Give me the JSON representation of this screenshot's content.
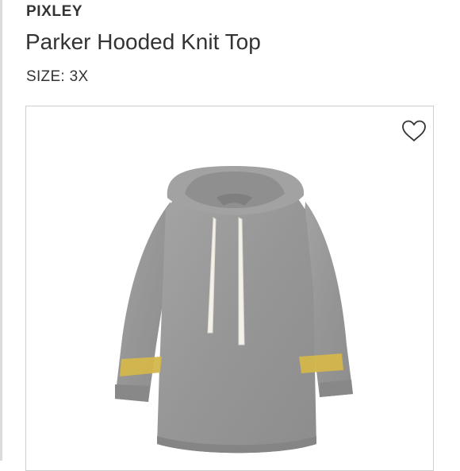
{
  "product": {
    "brand": "PIXLEY",
    "name": "Parker Hooded Knit Top",
    "size_label": "SIZE: 3X"
  },
  "image_card": {
    "favorite_icon": "heart-outline-icon",
    "garment_color": "#9a9a9a",
    "stripe_color": "#d4b64a",
    "drawstring_color": "#f4f1ea"
  }
}
